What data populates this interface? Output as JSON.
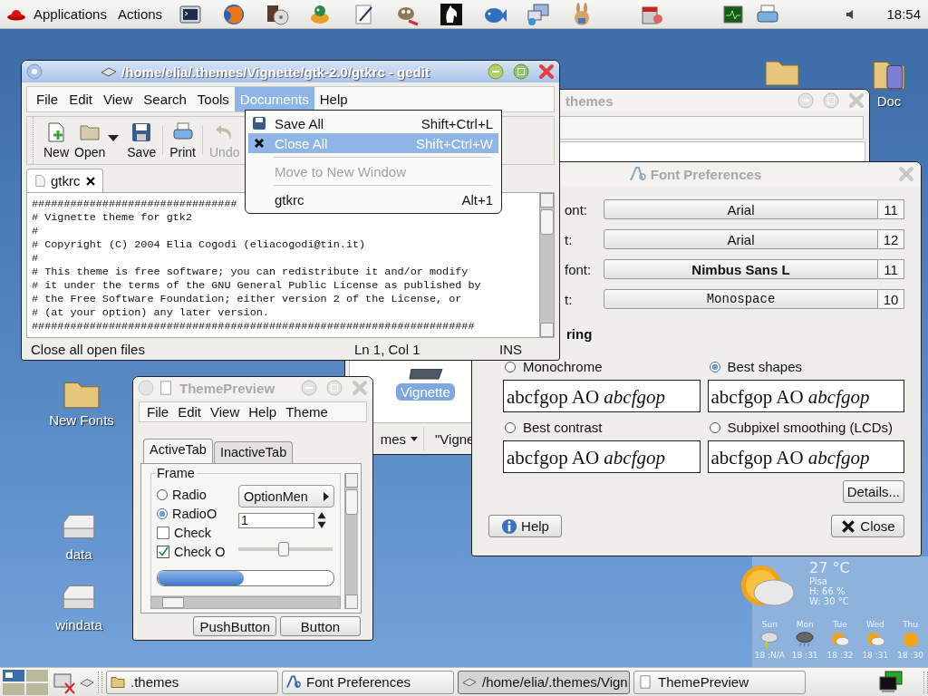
{
  "top_panel": {
    "menus": [
      "Applications",
      "Actions"
    ],
    "clock": "18:54"
  },
  "desktop_icons": [
    {
      "label": "Doc",
      "kind": "document"
    },
    {
      "label": "New Fonts",
      "kind": "folder"
    },
    {
      "label": "data",
      "kind": "drive"
    },
    {
      "label": "windata",
      "kind": "drive"
    }
  ],
  "themes_window": {
    "title": "themes",
    "selected_item": "Vignette",
    "path_button": "mes",
    "location_text": "\"Vigne"
  },
  "gedit": {
    "title": "/home/elia/.themes/Vignette/gtk-2.0/gtkrc - gedit",
    "menu": [
      {
        "label": "File",
        "selected": false
      },
      {
        "label": "Edit",
        "selected": false
      },
      {
        "label": "View",
        "selected": false
      },
      {
        "label": "Search",
        "selected": false
      },
      {
        "label": "Tools",
        "selected": false
      },
      {
        "label": "Documents",
        "selected": true
      },
      {
        "label": "Help",
        "selected": false
      }
    ],
    "toolbar": [
      {
        "label": "New",
        "kind": "new",
        "disabled": false
      },
      {
        "label": "Open",
        "kind": "open",
        "disabled": false
      },
      {
        "label": "Save",
        "kind": "save",
        "disabled": false
      },
      {
        "label": "Print",
        "kind": "print",
        "disabled": false
      },
      {
        "label": "Undo",
        "kind": "undo",
        "disabled": true
      }
    ],
    "tabs": [
      {
        "label": "gtkrc",
        "selected": true
      }
    ],
    "lines": [
      "################################",
      "# Vignette theme for gtk2",
      "#",
      "# Copyright (C) 2004 Elia Cogodi (eliacogodi@tin.it)",
      "#",
      "# This theme is free software; you can redistribute it and/or modify",
      "# it under the terms of the GNU General Public License as published by",
      "# the Free Software Foundation; either version 2 of the License, or",
      "# (at your option) any later version.",
      "#####################################################################"
    ],
    "status": {
      "message": "Close all open files",
      "position": "Ln 1, Col 1",
      "mode": "INS"
    }
  },
  "documents_menu": {
    "items": [
      {
        "kind": "save",
        "label": "Save All",
        "shortcut": "Shift+Ctrl+L",
        "selected": false,
        "disabled": false
      },
      {
        "kind": "close",
        "label": "Close All",
        "shortcut": "Shift+Ctrl+W",
        "selected": true,
        "disabled": false
      },
      {
        "kind": "separator"
      },
      {
        "kind": "plain",
        "label": "Move to New Window",
        "selected": false,
        "disabled": true
      },
      {
        "kind": "separator"
      },
      {
        "kind": "plain",
        "label": "gtkrc",
        "shortcut": "Alt+1",
        "selected": false,
        "disabled": false
      }
    ]
  },
  "font_preferences": {
    "title": "Font Preferences",
    "fonts": [
      {
        "label": "ont:",
        "font": "Arial",
        "size": "11",
        "kind": "regular"
      },
      {
        "label": "t:",
        "font": "Arial",
        "size": "12",
        "kind": "regular"
      },
      {
        "label": "font:",
        "font": "Nimbus Sans L",
        "size": "11",
        "kind": "bold"
      },
      {
        "label": "t:",
        "font": "Monospace",
        "size": "10",
        "kind": "mono"
      }
    ],
    "rendering_heading": "ring",
    "options": [
      {
        "label": "Monochrome",
        "selected": false,
        "sample": "abcfgop AO *abcfgop*"
      },
      {
        "label": "Best shapes",
        "selected": true,
        "sample": "abcfgop AO *abcfgop*"
      },
      {
        "label": "Best contrast",
        "selected": false,
        "sample": "abcfgop AO *abcfgop*"
      },
      {
        "label": "Subpixel smoothing (LCDs)",
        "selected": false,
        "sample": "abcfgop AO *abcfgop*"
      }
    ],
    "details_button": "Details...",
    "help_button": "Help",
    "close_button": "Close"
  },
  "theme_preview": {
    "title": "ThemePreview",
    "menu": [
      "File",
      "Edit",
      "View",
      "Help",
      "Theme"
    ],
    "tabs": [
      {
        "label": "ActiveTab",
        "selected": true
      },
      {
        "label": "InactiveTab",
        "selected": false
      }
    ],
    "frame_label": "Frame",
    "toggles": [
      {
        "kind": "radio",
        "label": "Radio",
        "checked": false
      },
      {
        "kind": "radio",
        "label": "RadioO",
        "checked": true
      },
      {
        "kind": "check",
        "label": "Check",
        "checked": false
      },
      {
        "kind": "check",
        "label": "Check O",
        "checked": true
      }
    ],
    "option_menu": "OptionMen",
    "spin_value": "1",
    "slider": {
      "level": 0.49
    },
    "progress": {
      "level": 0.49
    },
    "buttons": [
      "PushButton",
      "Button"
    ]
  },
  "weather": {
    "temperature": "27 °C",
    "city": "Pisa",
    "humidity": "H: 66 %",
    "wind": "W: 30 °C",
    "days": [
      {
        "day": "Sun",
        "temps": "18 :N/A",
        "kind": "storm"
      },
      {
        "day": "Mon",
        "temps": "18 :31",
        "kind": "rain"
      },
      {
        "day": "Tue",
        "temps": "18 :32",
        "kind": "partly"
      },
      {
        "day": "Wed",
        "temps": "18 :31",
        "kind": "partly"
      },
      {
        "day": "Thu",
        "temps": "18 :30",
        "kind": "sunny"
      }
    ]
  },
  "taskbar": {
    "tasks": [
      {
        "label": ".themes",
        "kind": "folder",
        "selected": false
      },
      {
        "label": "Font Preferences",
        "kind": "font",
        "selected": false
      },
      {
        "label": "/home/elia/.themes/Vign",
        "kind": "editor",
        "selected": true
      },
      {
        "label": "ThemePreview",
        "kind": "document",
        "selected": false
      }
    ]
  }
}
